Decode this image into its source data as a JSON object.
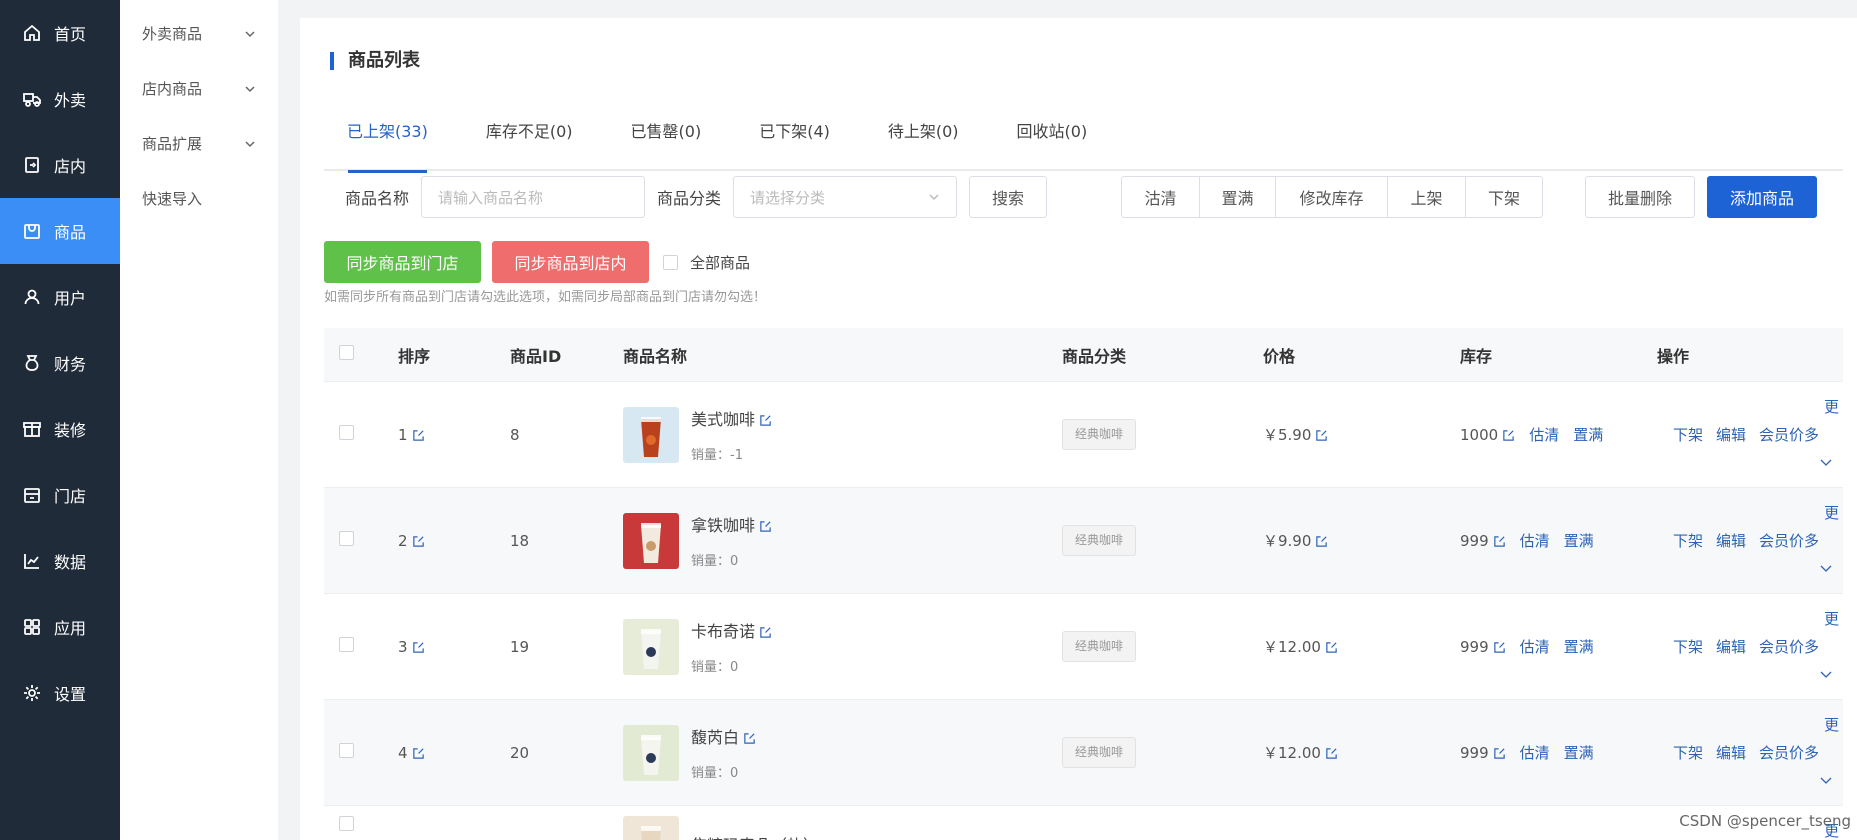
{
  "nav": [
    {
      "label": "首页",
      "icon": "home-icon"
    },
    {
      "label": "外卖",
      "icon": "delivery-icon"
    },
    {
      "label": "店内",
      "icon": "store-in-icon"
    },
    {
      "label": "商品",
      "icon": "goods-icon",
      "active": true
    },
    {
      "label": "用户",
      "icon": "user-icon"
    },
    {
      "label": "财务",
      "icon": "finance-icon"
    },
    {
      "label": "装修",
      "icon": "decorate-icon"
    },
    {
      "label": "门店",
      "icon": "shop-icon"
    },
    {
      "label": "数据",
      "icon": "chart-icon"
    },
    {
      "label": "应用",
      "icon": "apps-icon"
    },
    {
      "label": "设置",
      "icon": "gear-icon"
    }
  ],
  "submenu": [
    {
      "label": "外卖商品",
      "expandable": true
    },
    {
      "label": "店内商品",
      "expandable": true
    },
    {
      "label": "商品扩展",
      "expandable": true
    },
    {
      "label": "快速导入",
      "expandable": false
    }
  ],
  "page": {
    "title": "商品列表"
  },
  "tabs": [
    "已上架(33)",
    "库存不足(0)",
    "已售罄(0)",
    "已下架(4)",
    "待上架(0)",
    "回收站(0)"
  ],
  "filter": {
    "name_label": "商品名称",
    "name_placeholder": "请输入商品名称",
    "category_label": "商品分类",
    "category_placeholder": "请选择分类",
    "search": "搜索",
    "group": [
      "沽清",
      "置满",
      "修改库存",
      "上架",
      "下架"
    ],
    "batch_delete": "批量删除",
    "add": "添加商品"
  },
  "sync": {
    "to_store": "同步商品到门店",
    "to_instore": "同步商品到店内",
    "all_label": "全部商品",
    "hint": "如需同步所有商品到门店请勾选此选项，如需同步局部商品到门店请勿勾选！"
  },
  "table": {
    "headers": [
      "排序",
      "商品ID",
      "商品名称",
      "商品分类",
      "价格",
      "库存",
      "操作"
    ],
    "sales_prefix": "销量：",
    "rows": [
      {
        "sort": "1",
        "id": "8",
        "name": "美式咖啡",
        "sales": "-1",
        "category": "经典咖啡",
        "price": "￥5.90",
        "stock": "1000"
      },
      {
        "sort": "2",
        "id": "18",
        "name": "拿铁咖啡",
        "sales": "0",
        "category": "经典咖啡",
        "price": "￥9.90",
        "stock": "999"
      },
      {
        "sort": "3",
        "id": "19",
        "name": "卡布奇诺",
        "sales": "0",
        "category": "经典咖啡",
        "price": "￥12.00",
        "stock": "999"
      },
      {
        "sort": "4",
        "id": "20",
        "name": "馥芮白",
        "sales": "0",
        "category": "经典咖啡",
        "price": "￥12.00",
        "stock": "999"
      },
      {
        "sort": "",
        "id": "",
        "name": "焦糖玛奇朵（热）",
        "sales": "",
        "category": "",
        "price": "",
        "stock": ""
      }
    ],
    "stock_actions": [
      "估清",
      "置满"
    ],
    "row_actions": [
      "下架",
      "编辑",
      "会员价多"
    ],
    "more": "更"
  },
  "watermark": "CSDN @spencer_tseng",
  "colors": {
    "sidebar": "#202b3a",
    "active": "#3a8ef6",
    "primary": "#1d63d6",
    "green": "#5fc04a",
    "red": "#ef6d6d",
    "link": "#2d63b5"
  }
}
